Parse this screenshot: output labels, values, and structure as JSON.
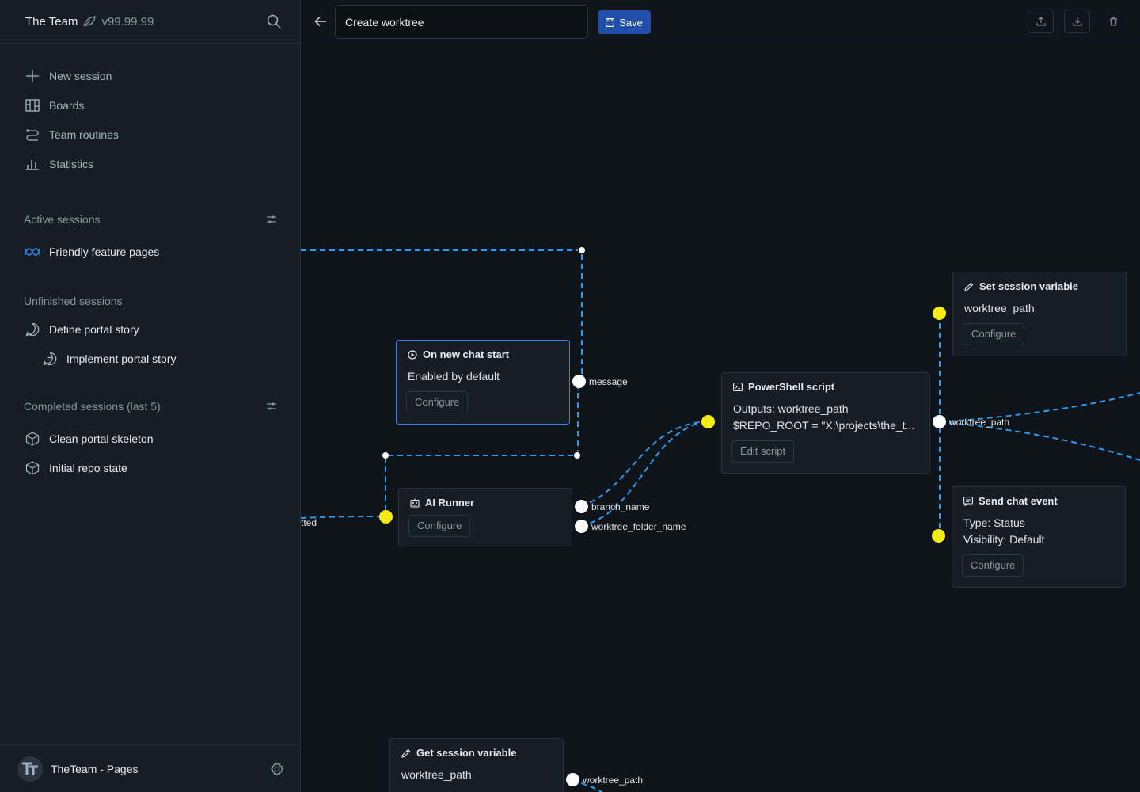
{
  "app": {
    "brand": "The Team",
    "version": "v99.99.99"
  },
  "nav": [
    {
      "label": "New session",
      "icon": "plus-icon"
    },
    {
      "label": "Boards",
      "icon": "board-icon"
    },
    {
      "label": "Team routines",
      "icon": "routine-icon"
    },
    {
      "label": "Statistics",
      "icon": "bar-chart-icon"
    }
  ],
  "sections": {
    "active": {
      "title": "Active sessions",
      "items": [
        {
          "label": "Friendly feature pages",
          "icon": "infinity-icon"
        }
      ]
    },
    "unfinished": {
      "title": "Unfinished sessions",
      "items": [
        {
          "label": "Define portal story",
          "icon": "chat-bubble-icon"
        },
        {
          "label": "Implement portal story",
          "icon": "chat-lines-icon"
        }
      ]
    },
    "completed": {
      "title": "Completed sessions (last 5)",
      "items": [
        {
          "label": "Clean portal skeleton",
          "icon": "package-icon"
        },
        {
          "label": "Initial repo state",
          "icon": "package-icon"
        }
      ]
    }
  },
  "footer": {
    "name": "TheTeam - Pages",
    "avatar": "TT"
  },
  "toolbar": {
    "title_value": "Create worktree",
    "save_label": "Save"
  },
  "nodes": {
    "chat_start": {
      "title": "On new chat start",
      "body": [
        "Enabled by default"
      ],
      "button": "Configure",
      "port": "message"
    },
    "ai_runner": {
      "title": "AI Runner",
      "button": "Configure",
      "ports": [
        "branch_name",
        "worktree_folder_name"
      ],
      "left_label": "tted"
    },
    "powershell": {
      "title": "PowerShell script",
      "body": [
        "Outputs: worktree_path",
        "$REPO_ROOT = \"X:\\projects\\the_t..."
      ],
      "button": "Edit script",
      "port": "worktree_path"
    },
    "set_var": {
      "title": "Set session variable",
      "body": [
        "worktree_path"
      ],
      "button": "Configure"
    },
    "send_event": {
      "title": "Send chat event",
      "body": [
        "Type: Status",
        "Visibility: Default"
      ],
      "button": "Configure"
    },
    "get_var": {
      "title": "Get session variable",
      "body": [
        "worktree_path"
      ],
      "port": "worktree_path"
    }
  },
  "colors": {
    "accent": "#1f4fa8",
    "wire": "#2f9bef",
    "port_in": "#f4ec13",
    "port_out": "#ffffff",
    "selected": "#3b82f6"
  }
}
